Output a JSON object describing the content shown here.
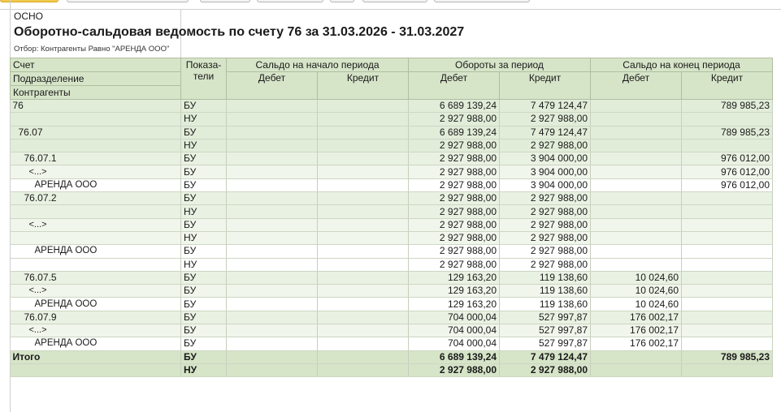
{
  "org": "ОСНО",
  "title": "Оборотно-сальдовая ведомость по счету 76 за 31.03.2026 - 31.03.2027",
  "filter": "Отбор: Контрагенты Равно \"АРЕНДА ООО\"",
  "headers": {
    "account": "Счет",
    "division": "Подразделение",
    "counterparty": "Контрагенты",
    "indicator_line1": "Показа-",
    "indicator_line2": "тели",
    "opening": "Сальдо на начало периода",
    "turnover": "Обороты за период",
    "closing": "Сальдо на конец периода",
    "debit": "Дебет",
    "credit": "Кредит"
  },
  "rows": [
    {
      "name": "76",
      "ind": "БУ",
      "od": "",
      "oc": "",
      "td": "6 689 139,24",
      "tc": "7 479 124,47",
      "cd": "",
      "cc": "789 985,23"
    },
    {
      "name": "",
      "ind": "НУ",
      "od": "",
      "oc": "",
      "td": "2 927 988,00",
      "tc": "2 927 988,00",
      "cd": "",
      "cc": ""
    },
    {
      "name": "76.07",
      "ind": "БУ",
      "od": "",
      "oc": "",
      "td": "6 689 139,24",
      "tc": "7 479 124,47",
      "cd": "",
      "cc": "789 985,23"
    },
    {
      "name": "",
      "ind": "НУ",
      "od": "",
      "oc": "",
      "td": "2 927 988,00",
      "tc": "2 927 988,00",
      "cd": "",
      "cc": ""
    },
    {
      "name": "76.07.1",
      "ind": "БУ",
      "od": "",
      "oc": "",
      "td": "2 927 988,00",
      "tc": "3 904 000,00",
      "cd": "",
      "cc": "976 012,00"
    },
    {
      "name": "<...>",
      "ind": "БУ",
      "od": "",
      "oc": "",
      "td": "2 927 988,00",
      "tc": "3 904 000,00",
      "cd": "",
      "cc": "976 012,00"
    },
    {
      "name": "АРЕНДА ООО",
      "ind": "БУ",
      "od": "",
      "oc": "",
      "td": "2 927 988,00",
      "tc": "3 904 000,00",
      "cd": "",
      "cc": "976 012,00"
    },
    {
      "name": "76.07.2",
      "ind": "БУ",
      "od": "",
      "oc": "",
      "td": "2 927 988,00",
      "tc": "2 927 988,00",
      "cd": "",
      "cc": ""
    },
    {
      "name": "",
      "ind": "НУ",
      "od": "",
      "oc": "",
      "td": "2 927 988,00",
      "tc": "2 927 988,00",
      "cd": "",
      "cc": ""
    },
    {
      "name": "<...>",
      "ind": "БУ",
      "od": "",
      "oc": "",
      "td": "2 927 988,00",
      "tc": "2 927 988,00",
      "cd": "",
      "cc": ""
    },
    {
      "name": "",
      "ind": "НУ",
      "od": "",
      "oc": "",
      "td": "2 927 988,00",
      "tc": "2 927 988,00",
      "cd": "",
      "cc": ""
    },
    {
      "name": "АРЕНДА ООО",
      "ind": "БУ",
      "od": "",
      "oc": "",
      "td": "2 927 988,00",
      "tc": "2 927 988,00",
      "cd": "",
      "cc": ""
    },
    {
      "name": "",
      "ind": "НУ",
      "od": "",
      "oc": "",
      "td": "2 927 988,00",
      "tc": "2 927 988,00",
      "cd": "",
      "cc": ""
    },
    {
      "name": "76.07.5",
      "ind": "БУ",
      "od": "",
      "oc": "",
      "td": "129 163,20",
      "tc": "119 138,60",
      "cd": "10 024,60",
      "cc": ""
    },
    {
      "name": "<...>",
      "ind": "БУ",
      "od": "",
      "oc": "",
      "td": "129 163,20",
      "tc": "119 138,60",
      "cd": "10 024,60",
      "cc": ""
    },
    {
      "name": "АРЕНДА ООО",
      "ind": "БУ",
      "od": "",
      "oc": "",
      "td": "129 163,20",
      "tc": "119 138,60",
      "cd": "10 024,60",
      "cc": ""
    },
    {
      "name": "76.07.9",
      "ind": "БУ",
      "od": "",
      "oc": "",
      "td": "704 000,04",
      "tc": "527 997,87",
      "cd": "176 002,17",
      "cc": ""
    },
    {
      "name": "<...>",
      "ind": "БУ",
      "od": "",
      "oc": "",
      "td": "704 000,04",
      "tc": "527 997,87",
      "cd": "176 002,17",
      "cc": ""
    },
    {
      "name": "АРЕНДА ООО",
      "ind": "БУ",
      "od": "",
      "oc": "",
      "td": "704 000,04",
      "tc": "527 997,87",
      "cd": "176 002,17",
      "cc": ""
    }
  ],
  "total": [
    {
      "name": "Итого",
      "ind": "БУ",
      "od": "",
      "oc": "",
      "td": "6 689 139,24",
      "tc": "7 479 124,47",
      "cd": "",
      "cc": "789 985,23"
    },
    {
      "name": "",
      "ind": "НУ",
      "od": "",
      "oc": "",
      "td": "2 927 988,00",
      "tc": "2 927 988,00",
      "cd": "",
      "cc": ""
    }
  ]
}
